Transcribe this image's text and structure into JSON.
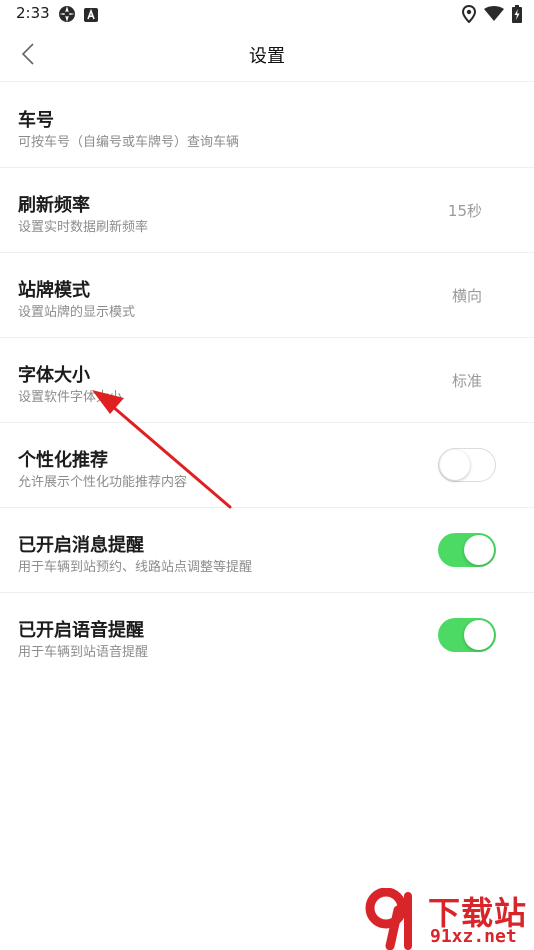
{
  "status_bar": {
    "time": "2:33",
    "left_icons": [
      "aperture-icon",
      "a-badge-icon"
    ],
    "right_icons": [
      "location-icon",
      "wifi-icon",
      "battery-charging-icon"
    ]
  },
  "header": {
    "title": "设置",
    "back_icon": "chevron-left-icon"
  },
  "settings": [
    {
      "title": "车号",
      "desc": "可按车号（自编号或车牌号）查询车辆",
      "value": "",
      "control": "none"
    },
    {
      "title": "刷新频率",
      "desc": "设置实时数据刷新频率",
      "value": "15秒",
      "control": "value"
    },
    {
      "title": "站牌模式",
      "desc": "设置站牌的显示模式",
      "value": "横向",
      "control": "value"
    },
    {
      "title": "字体大小",
      "desc": "设置软件字体大小",
      "value": "标准",
      "control": "value"
    },
    {
      "title": "个性化推荐",
      "desc": "允许展示个性化功能推荐内容",
      "value": "",
      "control": "toggle",
      "on": false
    },
    {
      "title": "已开启消息提醒",
      "desc": "用于车辆到站预约、线路站点调整等提醒",
      "value": "",
      "control": "toggle",
      "on": true
    },
    {
      "title": "已开启语音提醒",
      "desc": "用于车辆到站语音提醒",
      "value": "",
      "control": "toggle",
      "on": true
    }
  ],
  "watermark": {
    "title": "下载站",
    "url": "91xz.net"
  },
  "colors": {
    "toggle_on": "#4cd964",
    "annotation_arrow": "#e02020",
    "watermark": "#d8252a"
  }
}
